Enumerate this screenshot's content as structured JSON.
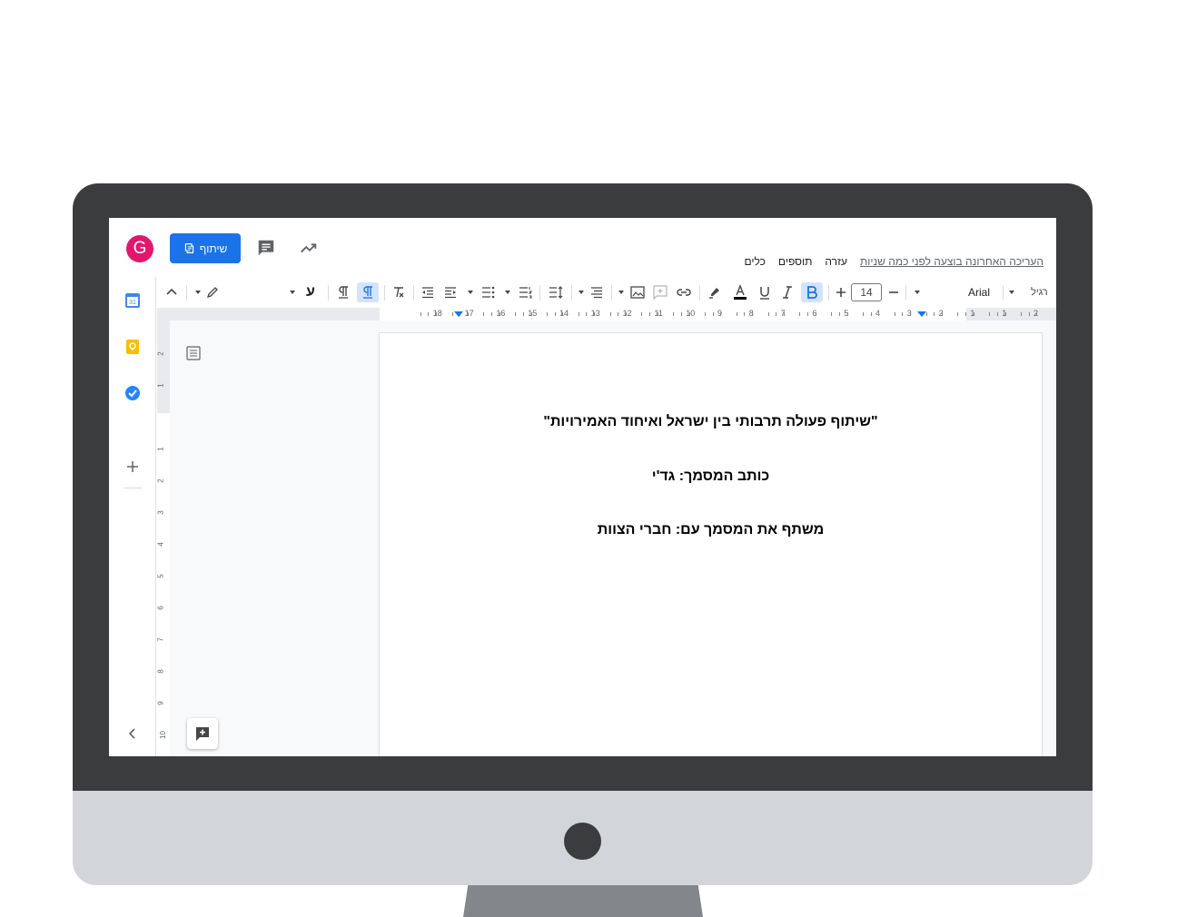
{
  "header": {
    "avatar_letter": "G",
    "share_label": "שיתוף",
    "last_edit": "העריכה האחרונה בוצעה לפני כמה שניות",
    "menu": [
      "כלים",
      "תוספים",
      "עזרה"
    ]
  },
  "toolbar": {
    "style_label": "רגיל",
    "font_label": "Arial",
    "font_size": "14",
    "rtl_label": "ע"
  },
  "ruler": {
    "numbers": [
      "2",
      "1",
      "1",
      "2",
      "3",
      "4",
      "5",
      "6",
      "7",
      "8",
      "9",
      "10",
      "11",
      "12",
      "13",
      "14",
      "15",
      "16",
      "17",
      "18"
    ]
  },
  "vruler": {
    "numbers": [
      "2",
      "1",
      "1",
      "2",
      "3",
      "4",
      "5",
      "6",
      "7",
      "8",
      "9",
      "10"
    ]
  },
  "document": {
    "title": "\"שיתוף פעולה תרבותי בין ישראל ואיחוד האמירויות\"",
    "author_line": "כותב המסמך:  גד'י",
    "shared_line": "משתף את המסמך עם: חברי הצוות"
  },
  "colors": {
    "accent": "#1a73e8",
    "avatar": "#e2176c",
    "bezel": "#3b3c3e",
    "chin": "#d2d6da",
    "stand": "#83868a"
  }
}
